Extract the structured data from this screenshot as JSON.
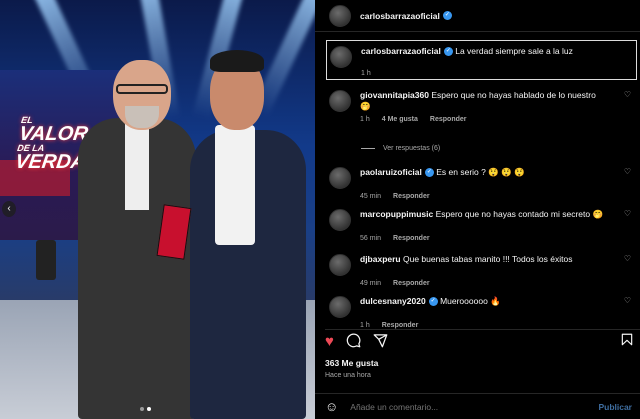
{
  "post": {
    "author": "carlosbarrazaoficial",
    "caption": "La verdad siempre sale a la luz",
    "caption_time": "1 h",
    "likes_label": "363 Me gusta",
    "posted": "Hace una hora",
    "show_logo_lines": [
      "EL",
      "VALOR",
      "DE LA",
      "VERDAD"
    ],
    "carousel_prev": "‹"
  },
  "comments": [
    {
      "user": "giovannitapia360",
      "verified": false,
      "text": "Espero que no hayas hablado de lo nuestro",
      "emoji": "🤭",
      "time": "1 h",
      "likes": "4 Me gusta",
      "reply": "Responder"
    },
    {
      "user": "paolaruizoficial",
      "verified": true,
      "text": "Es en serio ?",
      "emoji": "😲 😲 😲",
      "time": "45 min",
      "likes": "",
      "reply": "Responder"
    },
    {
      "user": "marcopuppimusic",
      "verified": false,
      "text": "Espero que no hayas contado mi secreto",
      "emoji": "🤭",
      "time": "56 min",
      "likes": "",
      "reply": "Responder"
    },
    {
      "user": "djbaxperu",
      "verified": false,
      "text": "Que buenas tabas manito !!! Todos los éxitos",
      "emoji": "",
      "time": "49 min",
      "likes": "",
      "reply": "Responder"
    },
    {
      "user": "dulcesnany2020",
      "verified": true,
      "text": "Mueroooooo",
      "emoji": "🔥",
      "time": "1 h",
      "likes": "",
      "reply": "Responder"
    }
  ],
  "replies": {
    "label": "Ver respuestas (6)"
  },
  "composer": {
    "placeholder": "Añade un comentario...",
    "publish": "Publicar"
  },
  "colors": {
    "accent": "#3897f0",
    "like": "#ed4956"
  },
  "icons": {
    "like": "heart-icon",
    "comment": "comment-icon",
    "share": "share-icon",
    "save": "bookmark-icon",
    "emoji": "emoji-icon"
  }
}
